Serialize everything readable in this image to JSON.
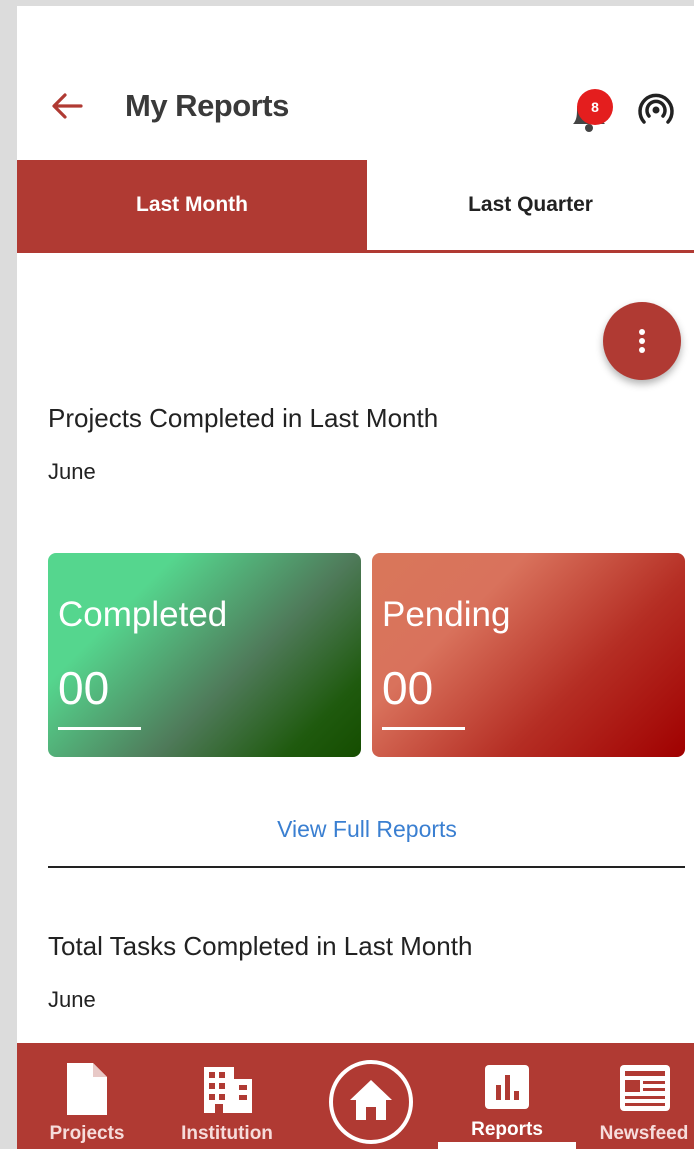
{
  "header": {
    "title": "My Reports",
    "back_icon": "arrow-left-icon",
    "notification_count": "8",
    "broadcast_icon": "broadcast-icon"
  },
  "tabs": [
    {
      "label": "Last Month",
      "active": true
    },
    {
      "label": "Last Quarter",
      "active": false
    }
  ],
  "projects_section": {
    "title": "Projects Completed in Last Month",
    "period": "June",
    "cards": [
      {
        "label": "Completed",
        "value": "00"
      },
      {
        "label": "Pending",
        "value": "00"
      }
    ],
    "link": "View Full Reports"
  },
  "tasks_section": {
    "title": "Total Tasks Completed in Last Month",
    "period": "June"
  },
  "bottom_nav": {
    "items": [
      {
        "label": "Projects",
        "icon": "document-icon"
      },
      {
        "label": "Institution",
        "icon": "building-icon"
      },
      {
        "label": "",
        "icon": "home-icon"
      },
      {
        "label": "Reports",
        "icon": "bar-chart-icon"
      },
      {
        "label": "Newsfeed",
        "icon": "newspaper-icon"
      }
    ],
    "active": "Reports"
  },
  "colors": {
    "primary": "#b03a33",
    "link": "#3a7fd1",
    "badge": "#e41e1e",
    "completed_gradient": [
      "#55d68e",
      "#154d00"
    ],
    "pending_gradient": [
      "#d9775a",
      "#a00000"
    ]
  }
}
